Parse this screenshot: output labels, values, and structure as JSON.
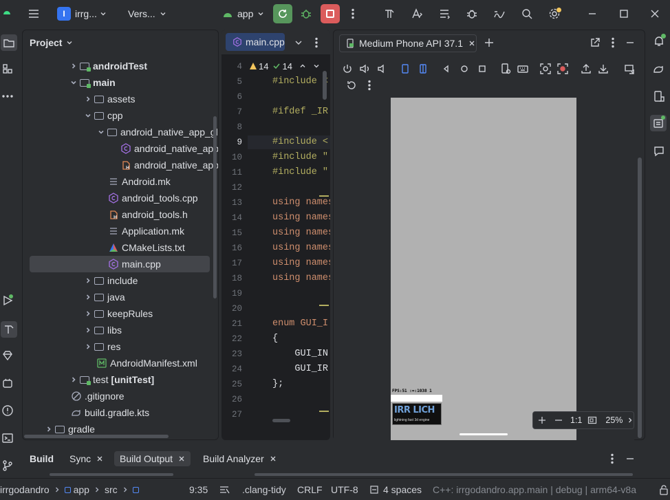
{
  "titlebar": {
    "project_initial": "I",
    "project_name": "irrg...",
    "vcs": "Vers...",
    "run_config": "app"
  },
  "project_panel": {
    "title": "Project",
    "tree": [
      {
        "label": "androidTest",
        "bold": true
      },
      {
        "label": "main",
        "bold": true
      },
      {
        "label": "assets"
      },
      {
        "label": "cpp"
      },
      {
        "label": "android_native_app_glue"
      },
      {
        "label": "android_native_app_glue.c"
      },
      {
        "label": "android_native_app_glue.h"
      },
      {
        "label": "Android.mk"
      },
      {
        "label": "android_tools.cpp"
      },
      {
        "label": "android_tools.h"
      },
      {
        "label": "Application.mk"
      },
      {
        "label": "CMakeLists.txt"
      },
      {
        "label": "main.cpp"
      },
      {
        "label": "include"
      },
      {
        "label": "java"
      },
      {
        "label": "keepRules"
      },
      {
        "label": "libs"
      },
      {
        "label": "res"
      },
      {
        "label": "AndroidManifest.xml"
      },
      {
        "label": "test",
        "suffix": "[unitTest]"
      },
      {
        "label": ".gitignore"
      },
      {
        "label": "build.gradle.kts"
      },
      {
        "label": "gradle"
      }
    ]
  },
  "editor": {
    "tab": "main.cpp",
    "warnings": "14",
    "checks": "14",
    "line_numbers": [
      "4",
      "5",
      "6",
      "7",
      "8",
      "9",
      "10",
      "11",
      "12",
      "13",
      "14",
      "15",
      "16",
      "17",
      "18",
      "19",
      "20",
      "21",
      "22",
      "23",
      "24",
      "25",
      "26",
      "27"
    ],
    "lines": {
      "l5": "#include <",
      "l7": "#ifdef _IR",
      "l9": "#include <",
      "l10": "#include \"",
      "l11": "#include \"",
      "l13": "using names",
      "l14": "using names",
      "l15": "using names",
      "l16": "using names",
      "l17": "using names",
      "l18": "using names",
      "l21": "enum GUI_I",
      "l22": "{",
      "l23": "    GUI_IN",
      "l24": "    GUI_IR",
      "l25": "};"
    }
  },
  "emulator": {
    "device_tab": "Medium Phone API 37.1",
    "screen_text_fps": "FPS:51 :=:1038 1",
    "logo_text": "IRR LICH",
    "logo_tagline": "lightning fast 3d engine",
    "zoom_ratio": "1:1",
    "zoom_level": "25%"
  },
  "bottom_panel": {
    "tabs": [
      "Build",
      "Sync",
      "Build Output",
      "Build Analyzer"
    ]
  },
  "statusbar": {
    "breadcrumb": [
      "irrgodandro",
      "app",
      "src"
    ],
    "position": "9:35",
    "formatter": ".clang-tidy",
    "line_ending": "CRLF",
    "encoding": "UTF-8",
    "indent": "4 spaces",
    "context": "C++: irrgodandro.app.main | debug | arm64-v8a"
  },
  "colors": {
    "accent": "#3574f0",
    "run_green": "#57965c",
    "stop_red": "#db5c5c",
    "code_keyword": "#cf8e6d",
    "code_preproc": "#b3ae60"
  }
}
